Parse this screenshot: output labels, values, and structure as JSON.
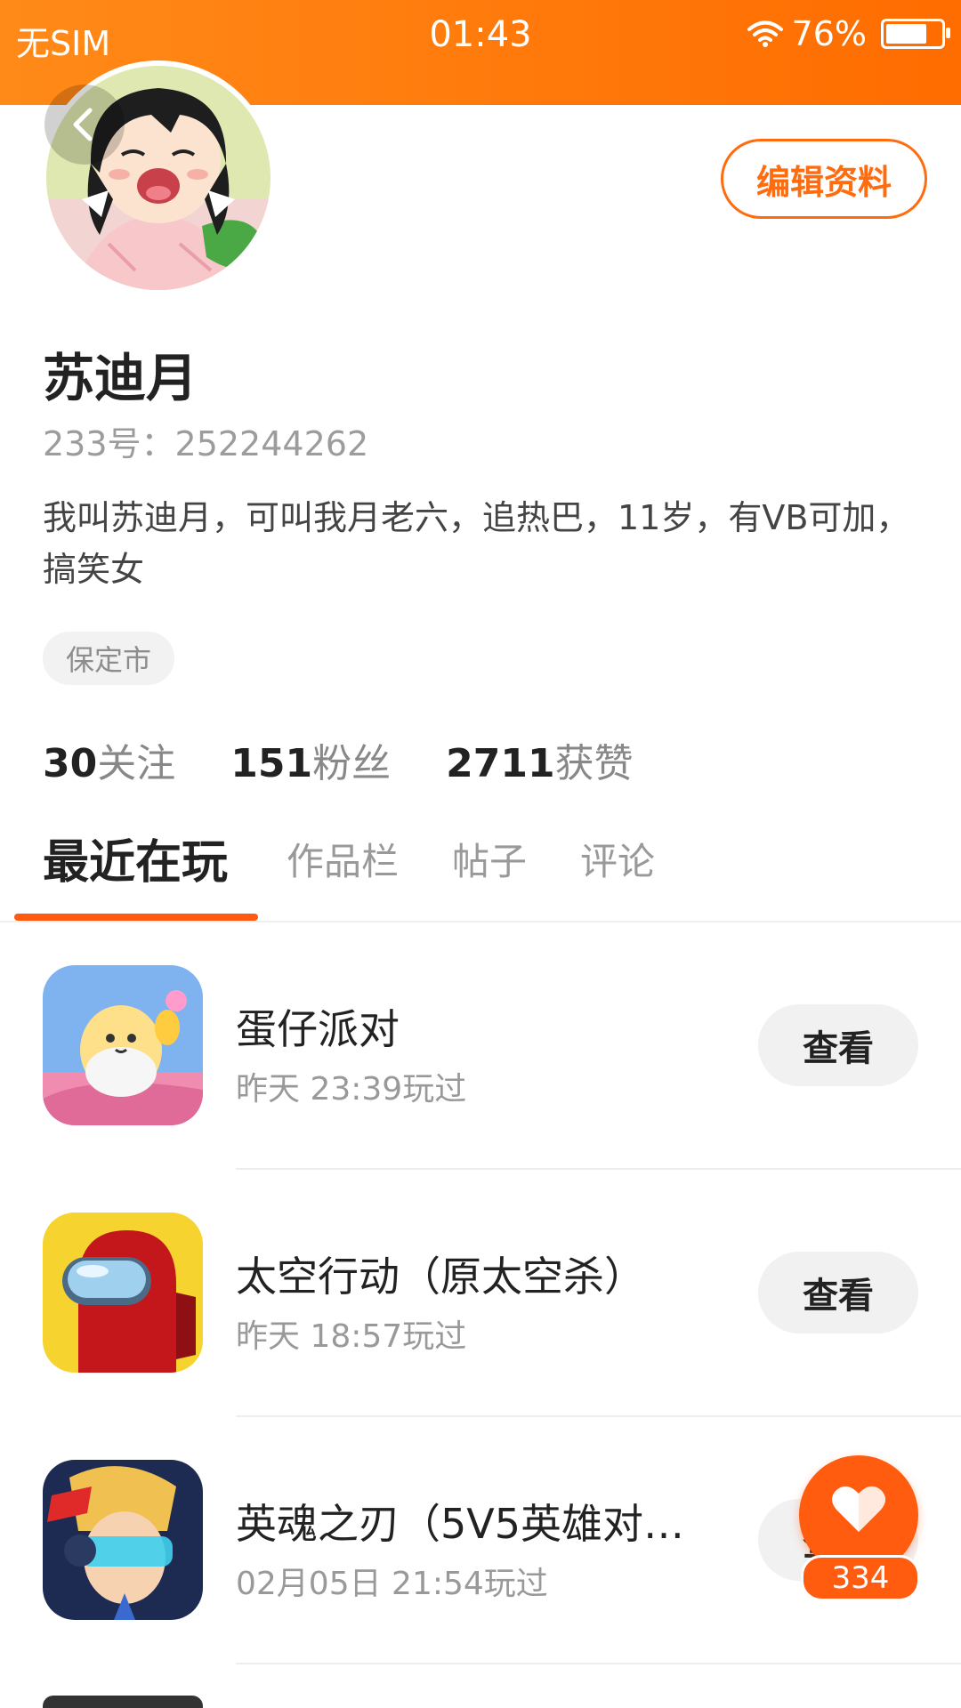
{
  "status_bar": {
    "carrier": "无SIM",
    "time": "01:43",
    "battery": "76%",
    "battery_level": 0.76
  },
  "profile": {
    "name": "苏迪月",
    "uid": "233号：252244262",
    "bio": "我叫苏迪月，可叫我月老六，追热巴，11岁，有VB可加，搞笑女",
    "city": "保定市",
    "edit_label": "编辑资料"
  },
  "stats": [
    {
      "count": "30",
      "label": "关注"
    },
    {
      "count": "151",
      "label": "粉丝"
    },
    {
      "count": "2711",
      "label": "获赞"
    }
  ],
  "tabs": [
    {
      "label": "最近在玩"
    },
    {
      "label": "作品栏"
    },
    {
      "label": "帖子"
    },
    {
      "label": "评论"
    }
  ],
  "games": [
    {
      "title": "蛋仔派对",
      "time": "昨天 23:39玩过",
      "action": "查看"
    },
    {
      "title": "太空行动（原太空杀）",
      "time": "昨天 18:57玩过",
      "action": "查看"
    },
    {
      "title": "英魂之刃（5V5英雄对…",
      "time": "02月05日 21:54玩过",
      "action": "查看"
    }
  ],
  "like_fab": {
    "count": "334"
  },
  "colors": {
    "accent": "#ff6c10",
    "status_bar": "#ff7a10"
  }
}
